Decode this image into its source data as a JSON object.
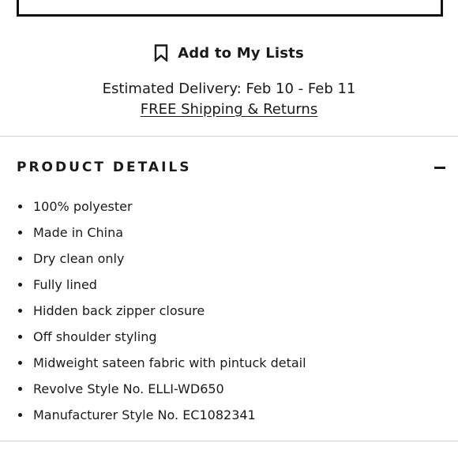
{
  "actions": {
    "add_to_lists_label": "Add to My Lists",
    "add_to_lists_icon": "bookmark-icon"
  },
  "delivery": {
    "estimate": "Estimated Delivery: Feb 10 - Feb 11",
    "shipping_link": "FREE Shipping & Returns"
  },
  "product_details": {
    "title": "PRODUCT DETAILS",
    "toggle_icon": "minus-icon",
    "items": [
      "100% polyester",
      "Made in China",
      "Dry clean only",
      "Fully lined",
      "Hidden back zipper closure",
      "Off shoulder styling",
      "Midweight sateen fabric with pintuck detail",
      "Revolve Style No. ELLI-WD650",
      "Manufacturer Style No. EC1082341"
    ]
  }
}
